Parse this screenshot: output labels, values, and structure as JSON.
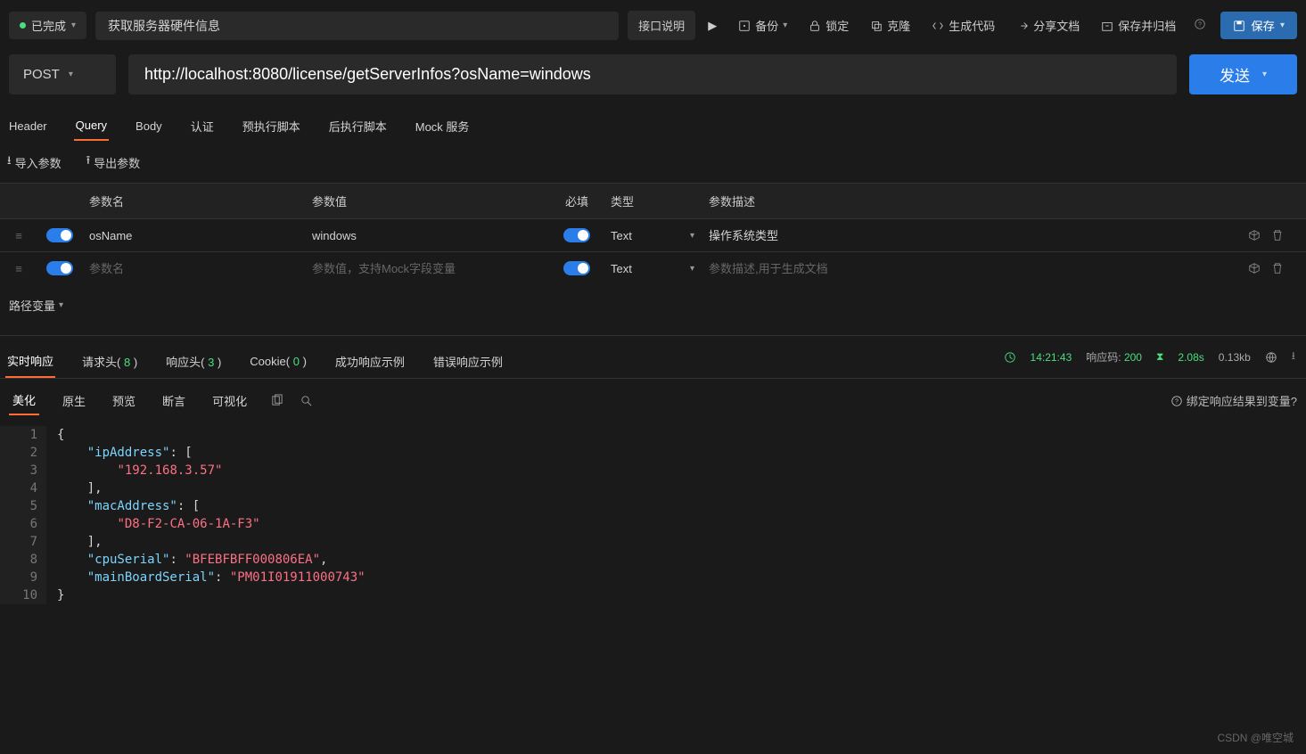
{
  "topbar": {
    "status_label": "已完成",
    "title": "获取服务器硬件信息",
    "api_desc": "接口说明",
    "play": "▶",
    "backup": "备份",
    "lock": "锁定",
    "clone": "克隆",
    "gen_code": "生成代码",
    "share_doc": "分享文档",
    "archive": "保存并归档",
    "save": "保存"
  },
  "request": {
    "method": "POST",
    "url": "http://localhost:8080/license/getServerInfos?osName=windows",
    "send": "发送"
  },
  "tabs": [
    "Header",
    "Query",
    "Body",
    "认证",
    "预执行脚本",
    "后执行脚本",
    "Mock 服务"
  ],
  "active_tab": "Query",
  "sub_actions": {
    "import": "导入参数",
    "export": "导出参数"
  },
  "param_headers": {
    "name": "参数名",
    "value": "参数值",
    "required": "必填",
    "type": "类型",
    "desc": "参数描述"
  },
  "params": [
    {
      "name": "osName",
      "value": "windows",
      "type": "Text",
      "desc": "操作系统类型",
      "required": true
    },
    {
      "name": "",
      "value": "",
      "type": "Text",
      "desc": "",
      "required": true
    }
  ],
  "param_placeholders": {
    "name": "参数名",
    "value": "参数值，支持Mock字段变量",
    "desc": "参数描述,用于生成文档"
  },
  "path_var": "路径变量",
  "resp_tabs": [
    {
      "label": "实时响应",
      "count": null
    },
    {
      "label": "请求头",
      "count": "8"
    },
    {
      "label": "响应头",
      "count": "3"
    },
    {
      "label": "Cookie",
      "count": "0"
    },
    {
      "label": "成功响应示例",
      "count": null
    },
    {
      "label": "错误响应示例",
      "count": null
    }
  ],
  "active_resp_tab": "实时响应",
  "resp_meta": {
    "time": "14:21:43",
    "status_label": "响应码:",
    "status_code": "200",
    "duration": "2.08s",
    "size": "0.13kb"
  },
  "view_tabs": [
    "美化",
    "原生",
    "预览",
    "断言",
    "可视化"
  ],
  "active_view_tab": "美化",
  "bind_hint": "绑定响应结果到变量?",
  "code_lines": [
    [
      {
        "t": "punct",
        "v": "{"
      }
    ],
    [
      {
        "t": "pad",
        "v": "    "
      },
      {
        "t": "key",
        "v": "\"ipAddress\""
      },
      {
        "t": "punct",
        "v": ": ["
      }
    ],
    [
      {
        "t": "pad",
        "v": "        "
      },
      {
        "t": "str",
        "v": "\"192.168.3.57\""
      }
    ],
    [
      {
        "t": "pad",
        "v": "    "
      },
      {
        "t": "punct",
        "v": "],"
      }
    ],
    [
      {
        "t": "pad",
        "v": "    "
      },
      {
        "t": "key",
        "v": "\"macAddress\""
      },
      {
        "t": "punct",
        "v": ": ["
      }
    ],
    [
      {
        "t": "pad",
        "v": "        "
      },
      {
        "t": "str",
        "v": "\"D8-F2-CA-06-1A-F3\""
      }
    ],
    [
      {
        "t": "pad",
        "v": "    "
      },
      {
        "t": "punct",
        "v": "],"
      }
    ],
    [
      {
        "t": "pad",
        "v": "    "
      },
      {
        "t": "key",
        "v": "\"cpuSerial\""
      },
      {
        "t": "punct",
        "v": ": "
      },
      {
        "t": "str",
        "v": "\"BFEBFBFF000806EA\""
      },
      {
        "t": "punct",
        "v": ","
      }
    ],
    [
      {
        "t": "pad",
        "v": "    "
      },
      {
        "t": "key",
        "v": "\"mainBoardSerial\""
      },
      {
        "t": "punct",
        "v": ": "
      },
      {
        "t": "str",
        "v": "\"PM01I01911000743\""
      }
    ],
    [
      {
        "t": "punct",
        "v": "}"
      }
    ]
  ],
  "watermark": "CSDN @唯空城"
}
